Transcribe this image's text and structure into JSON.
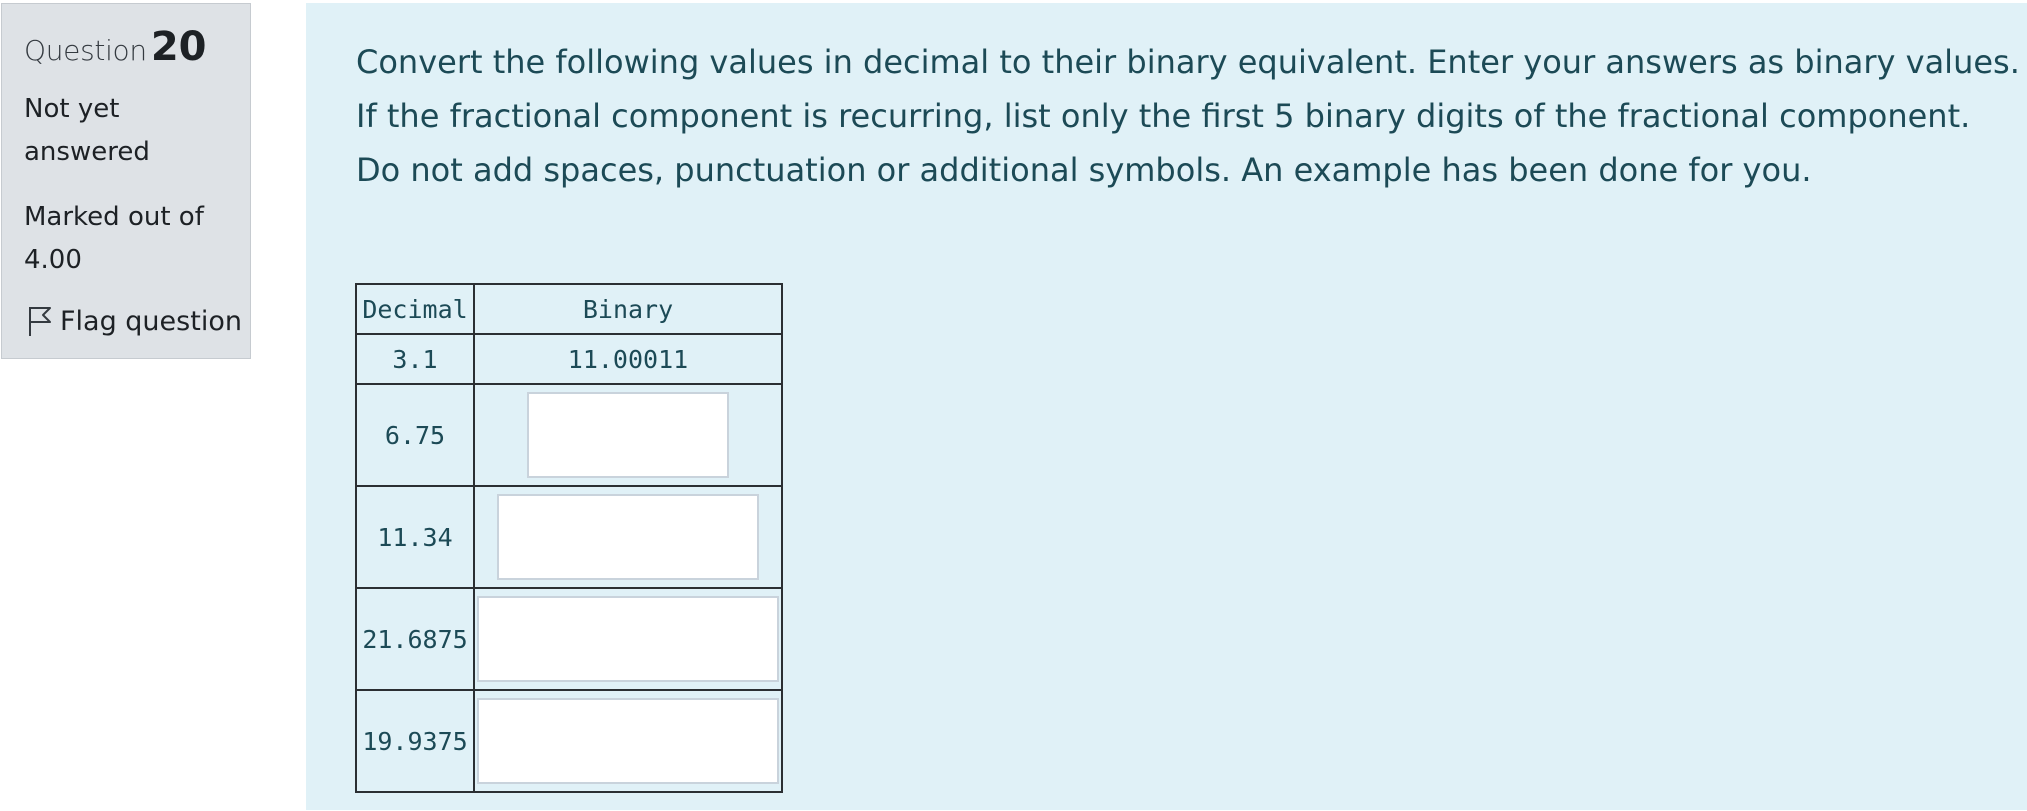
{
  "info": {
    "question_word": "Question",
    "question_number": "20",
    "state": "Not yet answered",
    "grade": "Marked out of 4.00",
    "flag_label": "Flag question"
  },
  "question": {
    "lines": [
      "Convert the following values in decimal to their binary equivalent. Enter your answers as binary values.",
      "If the fractional component is recurring, list only the first 5 binary digits of the fractional component.",
      "Do not add spaces, punctuation or additional symbols. An example has been done for you."
    ]
  },
  "table": {
    "headers": [
      "Decimal",
      "Binary"
    ],
    "example": {
      "decimal": "3.1",
      "binary": "11.00011"
    },
    "rows": [
      {
        "decimal": "6.75",
        "answer": ""
      },
      {
        "decimal": "11.34",
        "answer": ""
      },
      {
        "decimal": "21.6875",
        "answer": ""
      },
      {
        "decimal": "19.9375",
        "answer": ""
      }
    ]
  },
  "colors": {
    "info_bg": "#dee2e6",
    "content_bg": "#e0f1f7",
    "text_teal": "#1c4a56"
  },
  "icons": {
    "flag": "flag-outline-icon"
  }
}
